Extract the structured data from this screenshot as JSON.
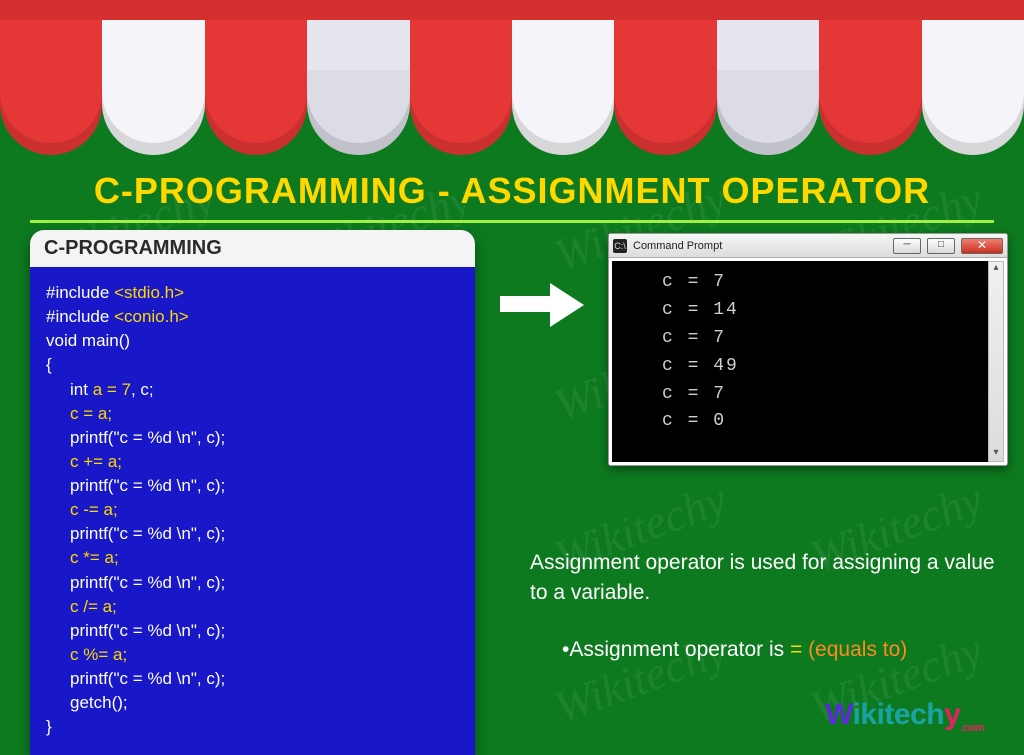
{
  "title": "C-PROGRAMMING - ASSIGNMENT OPERATOR",
  "code": {
    "header": "C-PROGRAMMING",
    "lines": [
      {
        "pre": "#include ",
        "kw": "<stdio.h>",
        "post": ""
      },
      {
        "pre": "#include ",
        "kw": "<conio.h>",
        "post": ""
      },
      {
        "pre": "void main()",
        "kw": "",
        "post": ""
      },
      {
        "pre": "{",
        "kw": "",
        "post": ""
      },
      {
        "pre": "int ",
        "kw": "a = 7",
        "post": ", c;",
        "ind": true
      },
      {
        "pre": "",
        "kw": "c = a;",
        "post": "",
        "ind": true
      },
      {
        "pre": "printf(\"c = %d \\n\", c);",
        "kw": "",
        "post": "",
        "ind": true
      },
      {
        "pre": "",
        "kw": "c += a;",
        "post": "",
        "ind": true
      },
      {
        "pre": "printf(\"c = %d \\n\", c);",
        "kw": "",
        "post": "",
        "ind": true
      },
      {
        "pre": "",
        "kw": "c -= a;",
        "post": "",
        "ind": true
      },
      {
        "pre": "printf(\"c = %d \\n\", c);",
        "kw": "",
        "post": "",
        "ind": true
      },
      {
        "pre": "",
        "kw": "c *= a;",
        "post": "",
        "ind": true
      },
      {
        "pre": "printf(\"c = %d \\n\", c);",
        "kw": "",
        "post": "",
        "ind": true
      },
      {
        "pre": "",
        "kw": "c /= a;",
        "post": "",
        "ind": true
      },
      {
        "pre": "printf(\"c = %d \\n\", c);",
        "kw": "",
        "post": "",
        "ind": true
      },
      {
        "pre": "",
        "kw": "c %= a;",
        "post": "",
        "ind": true
      },
      {
        "pre": "printf(\"c = %d \\n\", c);",
        "kw": "",
        "post": "",
        "ind": true
      },
      {
        "pre": "getch();",
        "kw": "",
        "post": "",
        "ind": true
      },
      {
        "pre": "}",
        "kw": "",
        "post": ""
      }
    ]
  },
  "console": {
    "title": "Command Prompt",
    "output": [
      "c = 7",
      "c = 14",
      "c = 7",
      "c = 49",
      "c = 7",
      "c = 0"
    ]
  },
  "explain": {
    "line1": "Assignment operator is used for assigning a value to a variable.",
    "bullet_pre": "•Assignment operator is ",
    "eq": "=",
    "paren": " (equals to)"
  },
  "logo": {
    "w": "W",
    "mid": "ikitech",
    "y": "y",
    "com": ".com"
  },
  "watermark": "Wikitechy",
  "win": {
    "min": "─",
    "max": "□",
    "close": "✕",
    "icon": "C:\\"
  }
}
